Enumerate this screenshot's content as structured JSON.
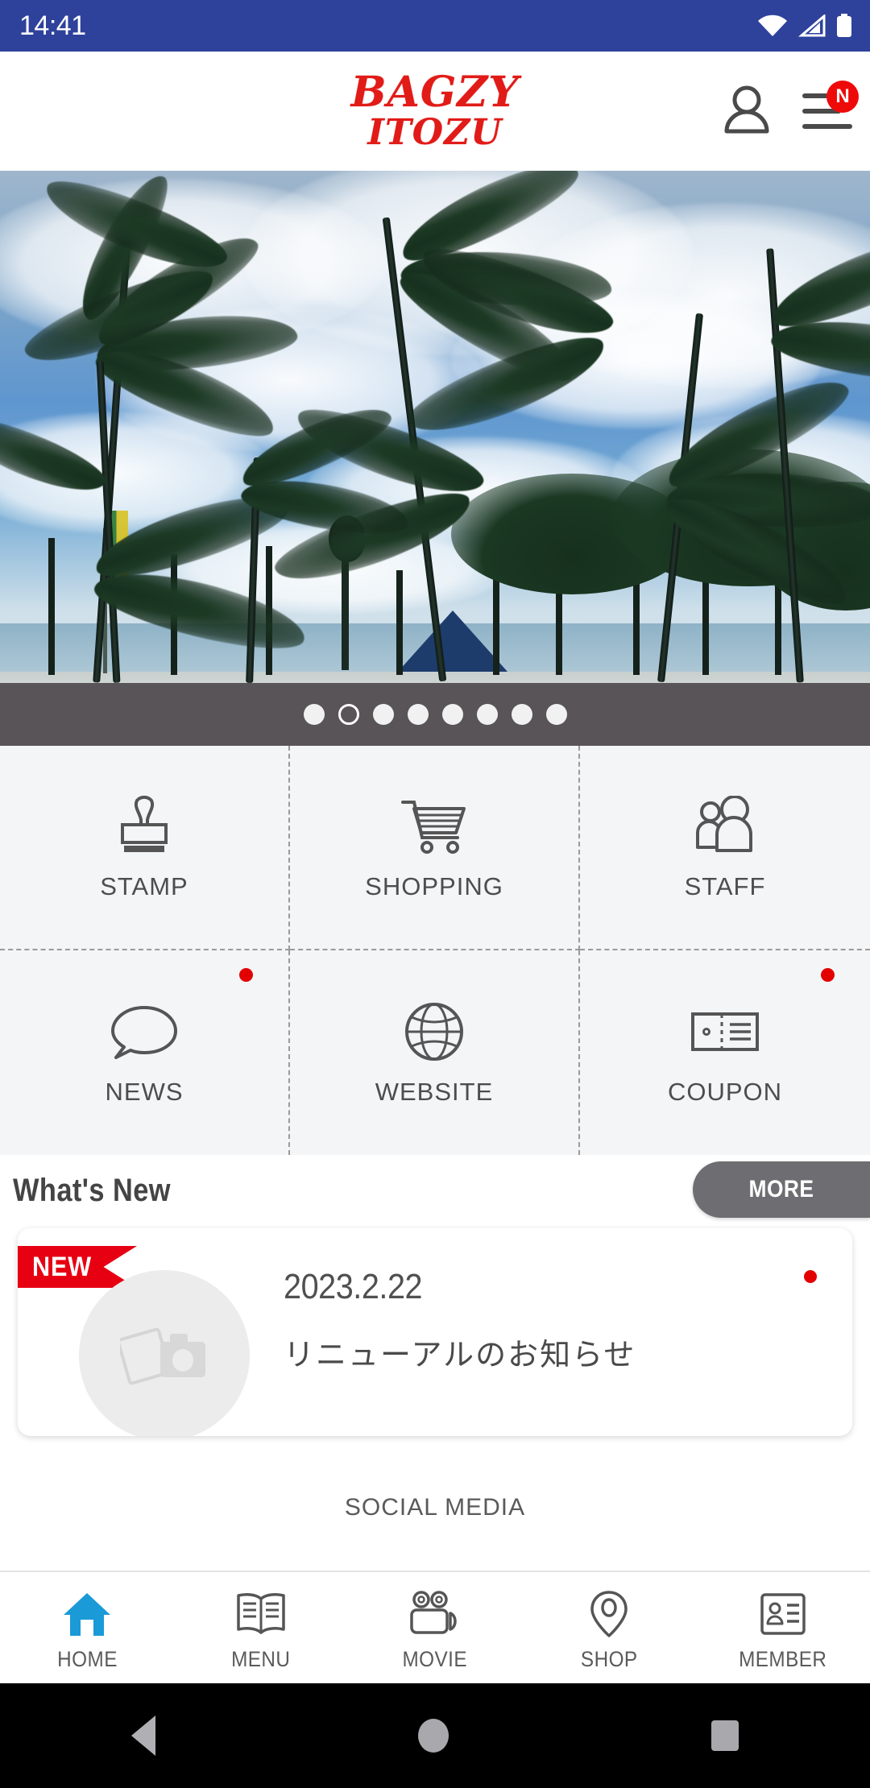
{
  "statusbar": {
    "time": "14:41",
    "icons": [
      "wifi-icon",
      "cellular-signal-icon",
      "battery-icon"
    ]
  },
  "header": {
    "logo_line1": "BAGZY",
    "logo_line2": "ITOZU",
    "logo_color": "#e11b17",
    "account_icon": "person-icon",
    "menu_icon": "hamburger-menu-icon",
    "menu_badge": "N",
    "badge_color": "#ef0a0a"
  },
  "hero": {
    "alt": "palm trees against blue sky over ocean beach",
    "slide_count": 8,
    "active_slide": 2,
    "dots_background": "#585458"
  },
  "grid": {
    "items": [
      {
        "label": "STAMP",
        "icon": "stamp-icon",
        "notification": false
      },
      {
        "label": "SHOPPING",
        "icon": "shopping-cart-icon",
        "notification": false
      },
      {
        "label": "STAFF",
        "icon": "people-icon",
        "notification": false
      },
      {
        "label": "NEWS",
        "icon": "speech-bubble-icon",
        "notification": true
      },
      {
        "label": "WEBSITE",
        "icon": "globe-icon",
        "notification": false
      },
      {
        "label": "COUPON",
        "icon": "ticket-icon",
        "notification": true
      }
    ],
    "notification_color": "#e30000"
  },
  "whats_new": {
    "title": "What's New",
    "more_label": "MORE",
    "more_button_color": "#6e6e72"
  },
  "news_card": {
    "badge": "NEW",
    "badge_color": "#e60012",
    "thumbnail_icon": "photo-camera-placeholder-icon",
    "date": "2023.2.22",
    "title": "リニューアルのお知らせ",
    "unread": true,
    "unread_color": "#e30000"
  },
  "social": {
    "label": "SOCIAL MEDIA"
  },
  "tabbar": {
    "active": "HOME",
    "active_color": "#1a9ad7",
    "items": [
      {
        "label": "HOME",
        "icon": "home-icon"
      },
      {
        "label": "MENU",
        "icon": "open-book-icon"
      },
      {
        "label": "MOVIE",
        "icon": "video-camera-icon"
      },
      {
        "label": "SHOP",
        "icon": "map-pin-icon"
      },
      {
        "label": "MEMBER",
        "icon": "id-card-icon"
      }
    ]
  },
  "android_nav": {
    "back": "back-triangle-icon",
    "home": "home-circle-icon",
    "recents": "recents-square-icon"
  }
}
